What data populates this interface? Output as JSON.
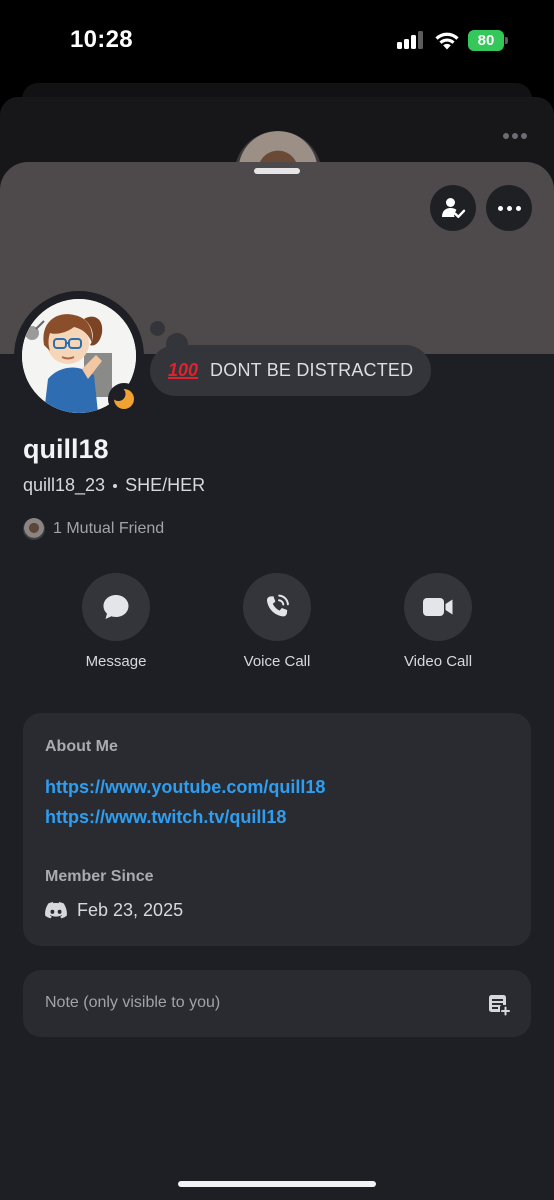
{
  "status_bar": {
    "time": "10:28",
    "battery": "80"
  },
  "profile": {
    "display_name": "quill18",
    "username": "quill18_23",
    "pronouns": "SHE/HER",
    "custom_status": {
      "emoji": "100",
      "text": "DONT BE DISTRACTED"
    },
    "mutual_friends": "1 Mutual Friend",
    "presence": "idle"
  },
  "actions": [
    {
      "label": "Message",
      "icon": "chat-bubble-icon"
    },
    {
      "label": "Voice Call",
      "icon": "phone-icon"
    },
    {
      "label": "Video Call",
      "icon": "video-camera-icon"
    }
  ],
  "about": {
    "title": "About Me",
    "links": [
      "https://www.youtube.com/quill18",
      "https://www.twitch.tv/quill18"
    ]
  },
  "member_since": {
    "title": "Member Since",
    "date": "Feb 23, 2025"
  },
  "note": {
    "placeholder": "Note (only visible to you)"
  },
  "colors": {
    "sheet_bg": "#1e1f24",
    "card_bg": "#2a2b31",
    "banner": "#4e4a4b",
    "link": "#2d9ef1",
    "idle": "#f0a232",
    "battery": "#34c759"
  }
}
